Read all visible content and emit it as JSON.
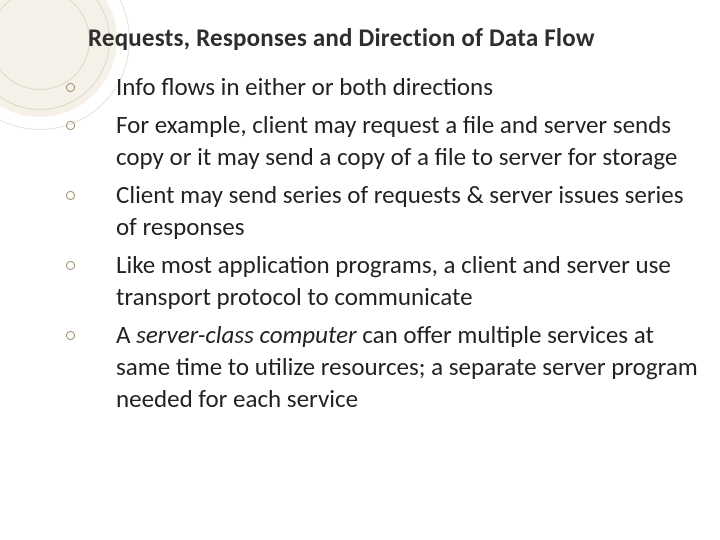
{
  "slide": {
    "title": "Requests, Responses and Direction of Data Flow",
    "bullets": [
      {
        "text": "Info flows in either or both directions"
      },
      {
        "text": "For example, client may request a file and server sends copy or it may send a copy of a file to server for storage"
      },
      {
        "text": "Client may send series of requests & server issues series of responses"
      },
      {
        "text": "Like most application programs, a client and server use transport protocol to communicate"
      },
      {
        "prefix": "A ",
        "italic": "server-class computer",
        "suffix": " can offer multiple services at same time to utilize resources; a separate server program needed for each service"
      }
    ]
  }
}
